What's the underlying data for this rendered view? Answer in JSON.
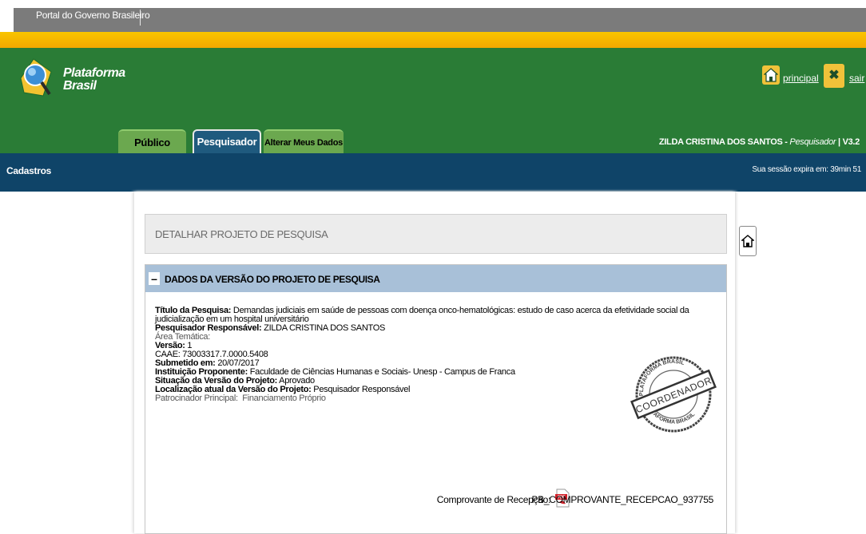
{
  "gov_bar": {
    "label": "Portal do Governo Brasileiro"
  },
  "logo": {
    "line1": "Plataforma",
    "line2": "Brasil"
  },
  "top_links": {
    "principal": "principal",
    "sair": "sair"
  },
  "tabs": [
    {
      "label": "Público"
    },
    {
      "label": "Pesquisador"
    },
    {
      "label": "Alterar Meus Dados"
    }
  ],
  "user": {
    "name": "ZILDA CRISTINA DOS SANTOS",
    "role": "Pesquisador",
    "version": "V3.2"
  },
  "navbar": {
    "menu": "Cadastros",
    "session": "Sua sessão expira em: 39min 51"
  },
  "page": {
    "title": "DETALHAR PROJETO DE PESQUISA"
  },
  "panel": {
    "collapse_symbol": "–",
    "title": "DADOS DA VERSÃO DO PROJETO DE PESQUISA",
    "titulo_label": "Título da Pesquisa:",
    "titulo_value": "Demandas judiciais em saúde de pessoas com doença onco-hematológicas: estudo de caso acerca da efetividade social da judicialização em um hospital universitário",
    "pesquisador_label": "Pesquisador Responsável:",
    "pesquisador_value": "ZILDA CRISTINA DOS SANTOS",
    "area_label": "Área Temática:",
    "versao_label": "Versão:",
    "versao_value": "1",
    "caae_label": "CAAE:",
    "caae_value": "73003317.7.0000.5408",
    "submetido_label": "Submetido em:",
    "submetido_value": "20/07/2017",
    "instituicao_label": "Instituição Proponente:",
    "instituicao_value": "Faculdade de Ciências Humanas e Sociais- Unesp - Campus de Franca",
    "situacao_label": "Situação da Versão do Projeto:",
    "situacao_value": "Aprovado",
    "localizacao_label": "Localização atual da Versão do Projeto:",
    "localizacao_value": "Pesquisador Responsável",
    "patrocinador_label": "Patrocinador Principal:",
    "patrocinador_value": "Financiamento Próprio",
    "stamp": {
      "text": "COORDENADOR",
      "ring_text": "PLATAFORMA BRASIL"
    },
    "receipt_label": "Comprovante de Recepção:",
    "receipt_file": "PB_COMPROVANTE_RECEPCAO_937755"
  },
  "colors": {
    "header_green": "#2a7c36",
    "stripe_yellow": "#f3b400",
    "navbar_blue": "#0f4468",
    "panel_head": "#a8c0d8"
  }
}
